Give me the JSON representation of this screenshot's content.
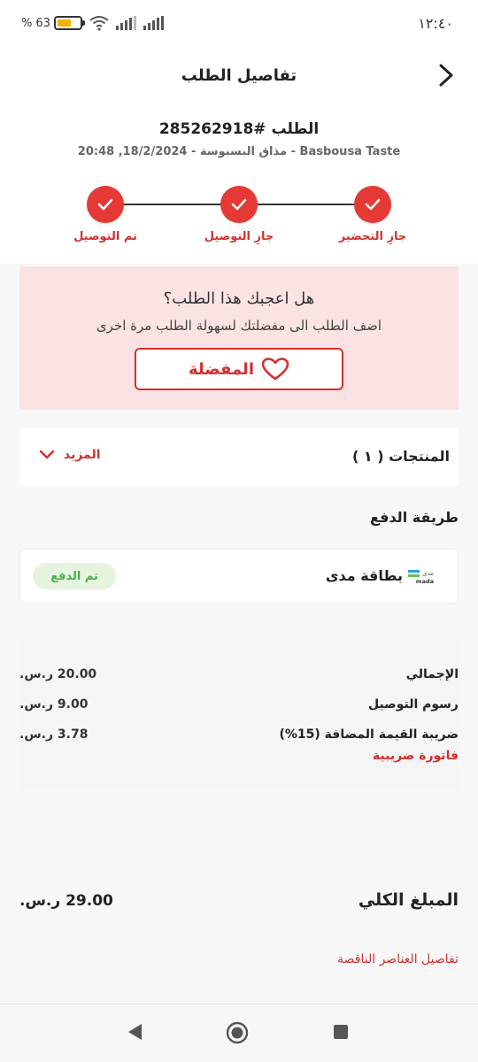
{
  "status_bar": {
    "time": "١٢:٤٠",
    "battery": "63",
    "battery_fraction": 0.63,
    "icons": [
      "battery-icon",
      "wifi-icon",
      "signal-icon",
      "signal-icon"
    ]
  },
  "header": {
    "title": "تفاصيل الطلب",
    "back_icon": "chevron-right-icon"
  },
  "order": {
    "number": "الطلب #285262918",
    "meta": "Basbousa Taste - مذاق البسبوسة  -  18/2/2024, 20:48"
  },
  "steps": [
    {
      "label": "جارِ التحضير",
      "done": true
    },
    {
      "label": "جارِ التوصيل",
      "done": true
    },
    {
      "label": "تم التوصيل",
      "done": true
    }
  ],
  "favorite": {
    "question": "هل اعجبك هذا الطلب؟",
    "subtitle": "اضف الطلب الى مفضلتك لسهولة الطلب مرة اخرى",
    "button_label": "المفضلة"
  },
  "products": {
    "title": "المنتجات ( ١ )",
    "more_label": "المزيد"
  },
  "payment": {
    "section_title": "طريقة الدفع",
    "method": "بطاقة مدى",
    "logo_text": "مدى",
    "logo_latin": "mada",
    "status": "تم الدفع"
  },
  "summary": {
    "rows": [
      {
        "label": "الإجمالي",
        "value": "20.00 ر.س."
      },
      {
        "label": "رسوم التوصيل",
        "value": "9.00 ر.س."
      },
      {
        "label": "ضريبة القيمة المضافة (15%)",
        "value": "3.78 ر.س."
      }
    ],
    "tax_invoice": "فاتورة ضريبية"
  },
  "total": {
    "label": "المبلغ الكلي",
    "value": "29.00 ر.س."
  },
  "missing_items_link": "تفاصيل العناصر الناقصة",
  "colors": {
    "accent": "#d32f2f",
    "step": "#e53935",
    "favorite_bg": "#fbe3e4",
    "paid_bg": "#e6f4df",
    "paid_text": "#4caf50"
  }
}
